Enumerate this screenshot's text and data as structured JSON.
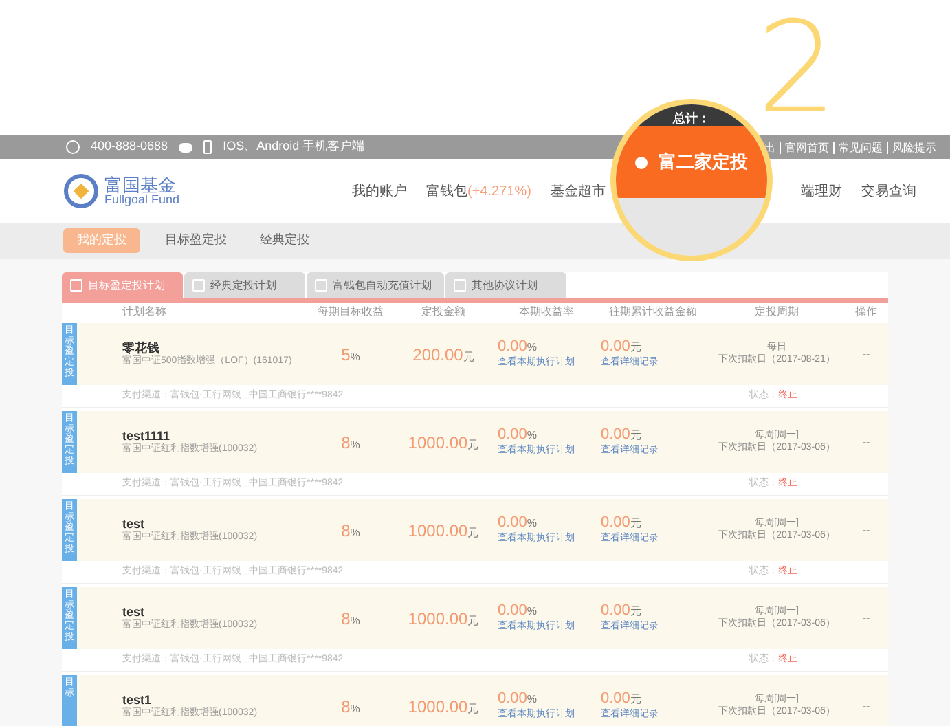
{
  "step_number": "2",
  "top_bar": {
    "phone": "400-888-0688",
    "app_text": "IOS、Android 手机客户端",
    "links": [
      "出",
      "官网首页",
      "常见问题",
      "风险提示"
    ]
  },
  "logo": {
    "name": "富国基金",
    "english": "Fullgoal Fund"
  },
  "nav": [
    {
      "label": "我的账户"
    },
    {
      "label": "富钱包",
      "extra": "(+4.271%)"
    },
    {
      "label": "基金超市"
    },
    {
      "label": "端理财"
    },
    {
      "label": "交易查询"
    }
  ],
  "magnifier": {
    "top_text": "总计：",
    "label": "富二家定投"
  },
  "sub_nav": [
    {
      "label": "我的定投",
      "selected": true
    },
    {
      "label": "目标盈定投",
      "selected": false
    },
    {
      "label": "经典定投",
      "selected": false
    }
  ],
  "plan_tabs": [
    {
      "label": "目标盈定投计划",
      "selected": true
    },
    {
      "label": "经典定投计划",
      "selected": false
    },
    {
      "label": "富钱包自动充值计划",
      "selected": false
    },
    {
      "label": "其他协议计划",
      "selected": false
    }
  ],
  "columns": [
    "计划名称",
    "每期目标收益",
    "定投金额",
    "本期收益率",
    "往期累计收益金额",
    "定投周期",
    "操作"
  ],
  "rows": [
    {
      "badge": "目标盈定投",
      "name": "零花钱",
      "fund": "富国中证500指数增强（LOF）(161017)",
      "target": "5",
      "target_unit": "%",
      "amount": "200.00",
      "amount_unit": "元",
      "rate": "0.00",
      "rate_unit": "%",
      "rate_link": "查看本期执行计划",
      "total": "0.00",
      "total_unit": "元",
      "total_link": "查看详细记录",
      "period": "每日",
      "next": "下次扣款日（2017-08-21）",
      "op": "--",
      "pay": "支付渠道：富钱包-工行网银 _中国工商银行****9842",
      "status_label": "状态：",
      "status": "终止"
    },
    {
      "badge": "目标盈定投",
      "name": "test1111",
      "fund": "富国中证红利指数增强(100032)",
      "target": "8",
      "target_unit": "%",
      "amount": "1000.00",
      "amount_unit": "元",
      "rate": "0.00",
      "rate_unit": "%",
      "rate_link": "查看本期执行计划",
      "total": "0.00",
      "total_unit": "元",
      "total_link": "查看详细记录",
      "period": "每周[周一]",
      "next": "下次扣款日（2017-03-06）",
      "op": "--",
      "pay": "支付渠道：富钱包-工行网银 _中国工商银行****9842",
      "status_label": "状态：",
      "status": "终止"
    },
    {
      "badge": "目标盈定投",
      "name": "test",
      "fund": "富国中证红利指数增强(100032)",
      "target": "8",
      "target_unit": "%",
      "amount": "1000.00",
      "amount_unit": "元",
      "rate": "0.00",
      "rate_unit": "%",
      "rate_link": "查看本期执行计划",
      "total": "0.00",
      "total_unit": "元",
      "total_link": "查看详细记录",
      "period": "每周[周一]",
      "next": "下次扣款日（2017-03-06）",
      "op": "--",
      "pay": "支付渠道：富钱包-工行网银 _中国工商银行****9842",
      "status_label": "状态：",
      "status": "终止"
    },
    {
      "badge": "目标盈定投",
      "name": "test",
      "fund": "富国中证红利指数增强(100032)",
      "target": "8",
      "target_unit": "%",
      "amount": "1000.00",
      "amount_unit": "元",
      "rate": "0.00",
      "rate_unit": "%",
      "rate_link": "查看本期执行计划",
      "total": "0.00",
      "total_unit": "元",
      "total_link": "查看详细记录",
      "period": "每周[周一]",
      "next": "下次扣款日（2017-03-06）",
      "op": "--",
      "pay": "支付渠道：富钱包-工行网银 _中国工商银行****9842",
      "status_label": "状态：",
      "status": "终止"
    },
    {
      "badge": "目标",
      "name": "test1",
      "fund": "富国中证红利指数增强(100032)",
      "target": "8",
      "target_unit": "%",
      "amount": "1000.00",
      "amount_unit": "元",
      "rate": "0.00",
      "rate_unit": "%",
      "rate_link": "查看本期执行计划",
      "total": "0.00",
      "total_unit": "元",
      "total_link": "查看详细记录",
      "period": "每周[周一]",
      "next": "下次扣款日（2017-03-06）",
      "op": "--"
    }
  ]
}
